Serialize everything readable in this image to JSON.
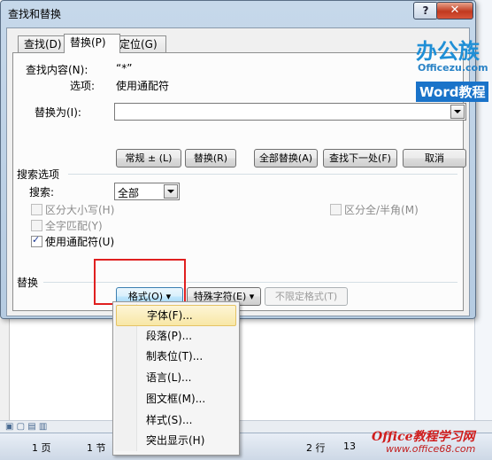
{
  "dialog": {
    "title": "查找和替换",
    "help_label": "?",
    "close_label": "✕",
    "tabs": [
      {
        "label": "查找(D)"
      },
      {
        "label": "替换(P)"
      },
      {
        "label": "定位(G)"
      }
    ],
    "find_label": "查找内容(N):",
    "find_value": "“*”",
    "options_label": "选项:",
    "options_value": "使用通配符",
    "replace_label": "替换为(I):",
    "replace_value": "",
    "buttons": {
      "less": "常规 ± (L)",
      "replace": "替换(R)",
      "replace_all": "全部替换(A)",
      "find_next": "查找下一处(F)",
      "cancel": "取消"
    },
    "search_options_title": "搜索选项",
    "search_label": "搜索:",
    "search_value": "全部",
    "checkboxes": [
      {
        "label": "区分大小写(H)",
        "checked": false,
        "disabled": true
      },
      {
        "label": "全字匹配(Y)",
        "checked": false,
        "disabled": true
      },
      {
        "label": "使用通配符(U)",
        "checked": true,
        "disabled": false
      },
      {
        "label": "区分全/半角(M)",
        "checked": false,
        "disabled": true
      }
    ],
    "replace_section_title": "替换",
    "format_button": "格式(O) ▾",
    "special_button": "特殊字符(E) ▾",
    "no_format_button": "不限定格式(T)"
  },
  "format_menu": {
    "items": [
      {
        "label": "字体(F)..."
      },
      {
        "label": "段落(P)..."
      },
      {
        "label": "制表位(T)..."
      },
      {
        "label": "语言(L)..."
      },
      {
        "label": "图文框(M)..."
      },
      {
        "label": "样式(S)..."
      },
      {
        "label": "突出显示(H)"
      }
    ]
  },
  "statusbar": {
    "page": "1 页",
    "section": "1 节",
    "line": "2 行",
    "column": "13"
  },
  "watermarks": {
    "brand_cn": "办公族",
    "brand_site": "Officezu.com",
    "brand_word": "Word教程",
    "bottom_office": "Office教程学习网",
    "bottom_site": "www.office68.com"
  },
  "colors": {
    "titlebar": "#c6d8ea",
    "close_button": "#c0391f",
    "highlight_box": "#e02020",
    "menu_selected": "#f8e7a6"
  }
}
